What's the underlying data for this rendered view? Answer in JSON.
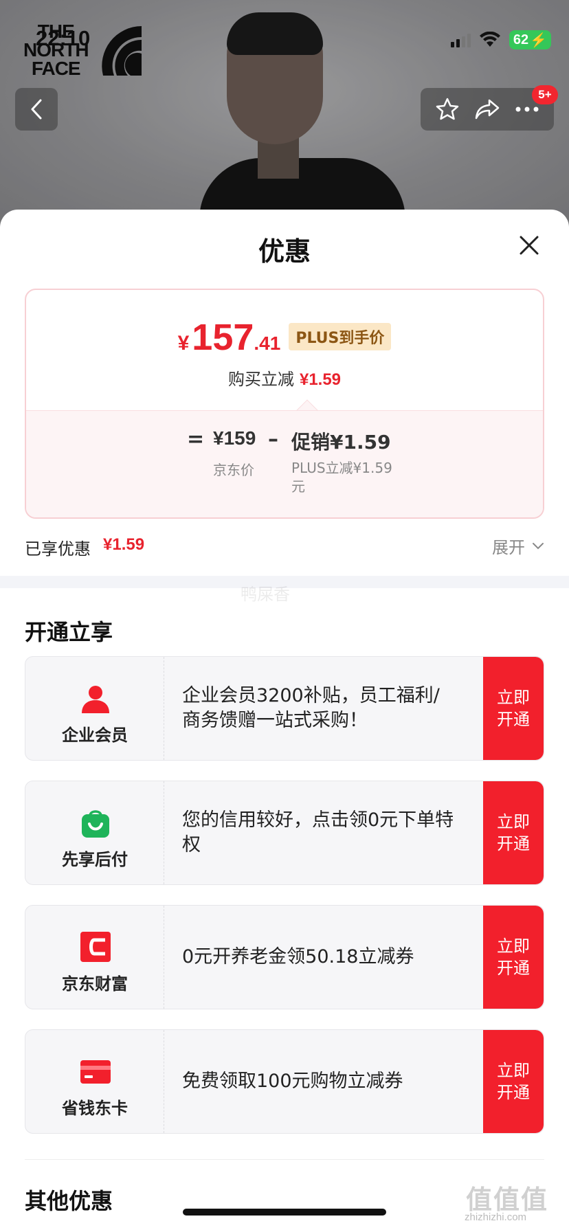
{
  "status_bar": {
    "time": "22:10",
    "battery": "62"
  },
  "brand": {
    "line1": "THE",
    "line2": "NORTH",
    "line3": "FACE"
  },
  "nav": {
    "message_badge": "5+"
  },
  "sheet": {
    "title": "优惠"
  },
  "price": {
    "currency": "¥",
    "integer": "157",
    "decimal": ".41",
    "plus_tag": "PLUS到手价",
    "reduce_label": "购买立减",
    "reduce_amount": "¥1.59",
    "equals": "=",
    "jd_price": "¥159",
    "minus": "–",
    "promo_label": "促销¥1.59",
    "jd_price_label": "京东价",
    "promo_detail": "PLUS立减¥1.59元"
  },
  "enjoyed": {
    "label": "已享优惠",
    "amount": "¥1.59",
    "expand_label": "展开"
  },
  "watermark": "鸭屎香",
  "open_section": {
    "title": "开通立享",
    "offers": [
      {
        "name": "企业会员",
        "icon": "user-icon",
        "desc": "企业会员3200补贴，员工福利/商务馈赠一站式采购！",
        "button": "立即开通"
      },
      {
        "name": "先享后付",
        "icon": "shopping-bag-icon",
        "desc": "您的信用较好，点击领0元下单特权",
        "button": "立即开通"
      },
      {
        "name": "京东财富",
        "icon": "wallet-icon",
        "desc": "0元开养老金领50.18立减券",
        "button": "立即开通"
      },
      {
        "name": "省钱东卡",
        "icon": "card-icon",
        "desc": "免费领取100元购物立减券",
        "button": "立即开通"
      }
    ]
  },
  "other_section": {
    "title": "其他优惠"
  },
  "site_watermark": {
    "mark": "值值值",
    "url": "zhizhizhi.com"
  },
  "colors": {
    "accent_red": "#f2202c",
    "price_red": "#e8232e",
    "plus_tag_bg": "#fbe7c6",
    "green": "#1fb45a"
  }
}
